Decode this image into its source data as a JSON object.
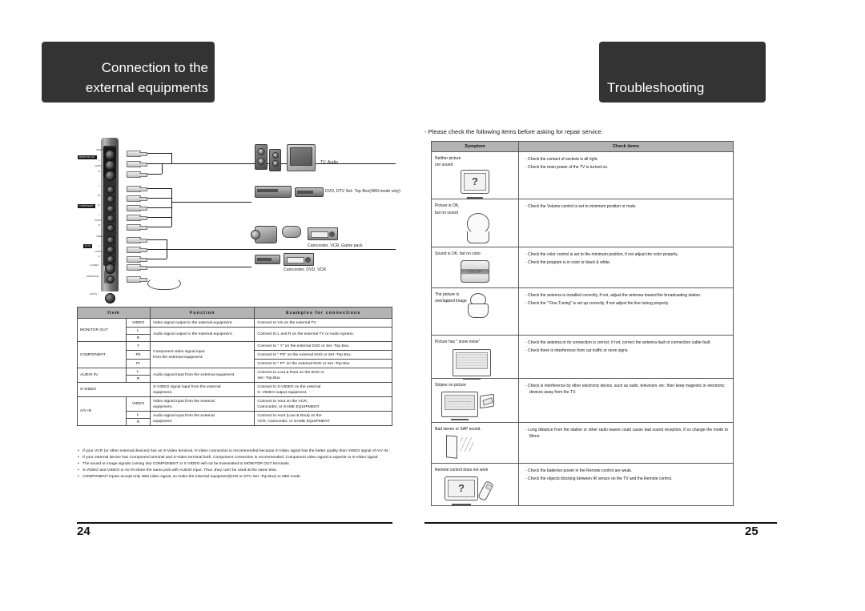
{
  "headers": {
    "left_line1": "Connection to the",
    "left_line2": "external equipments",
    "right": "Troubleshooting"
  },
  "left_page": {
    "page_number": "24",
    "diagram": {
      "panel_labels": [
        "VIDEO",
        "L",
        "AUDIO",
        "R",
        "Y",
        "Pb",
        "Pr",
        "L",
        "AUDIO",
        "R",
        "VIDEO",
        "L",
        "AUDIO",
        "R",
        "S-VIDEO",
        "EARPHONE",
        "ANT IN"
      ],
      "group_labels": [
        "MONITOR OUT",
        "COMPONENT",
        "AV IN"
      ],
      "device_captions": [
        "TV, Audio",
        "DVD, DTV Set- Top Box(480i mode only)",
        "Camcorder, VCR, Game pack",
        "Camcorder, DVD, VCR"
      ]
    },
    "table": {
      "headers": [
        "Item",
        "Function",
        "Examples for connections"
      ],
      "rows": [
        {
          "item": "MONITOR OUT",
          "sub": "VIDEO",
          "function": [
            "Video signal output to the external equipment."
          ],
          "example": [
            "Connect to Vin on the external TV."
          ]
        },
        {
          "item": "",
          "sub": "L",
          "function": [
            "Audio signal output to the external equipment."
          ],
          "example": [
            "Connect to L and R on the external TV or Audio system."
          ]
        },
        {
          "item": "",
          "sub": "R",
          "function": [],
          "example": []
        },
        {
          "item": "COMPONENT",
          "sub": "Y",
          "function": [
            "Component video signal input",
            "from the external equipment."
          ],
          "example": [
            "Connect to \" Y\"  on the external DVD or Set -Top Box."
          ]
        },
        {
          "item": "",
          "sub": "Pb",
          "function": [],
          "example": [
            "Connect to \" Pb\"  on the external DVD or Set -Top Box."
          ]
        },
        {
          "item": "",
          "sub": "Pr",
          "function": [],
          "example": [
            "Connect to \" Pr\"  on the external DVD or Set -Top Box"
          ]
        },
        {
          "item": "AUDIO IN",
          "sub": "L",
          "function": [
            "Audio signal input from the external equipment."
          ],
          "example": [
            "Connect to Lout & Rout on the DVD or",
            "Set -Top Box."
          ]
        },
        {
          "item": "",
          "sub": "R",
          "function": [],
          "example": []
        },
        {
          "item": "S-VIDEO",
          "sub": "",
          "function": [
            "S-VIDEO signal input from the external",
            "equipment."
          ],
          "example": [
            "Connect to S-VIDEO on the external",
            "S -VIDEO output equipment."
          ]
        },
        {
          "item": "A/V IN",
          "sub": "VIDEO",
          "function": [
            "Video signal input from the external",
            "equipment."
          ],
          "example": [
            "Connect to Vout on the VCR,",
            "Camcorder, or GAME EQUIPMENT."
          ]
        },
        {
          "item": "",
          "sub": "L",
          "function": [
            "Audio signal input from the external",
            "equipment."
          ],
          "example": [
            "Connect to Aout (Lout & Rout) on the",
            "VCR, Camcorder, or GAME EQUIPMENT."
          ]
        },
        {
          "item": "",
          "sub": "R",
          "function": [],
          "example": []
        }
      ]
    },
    "notes": [
      "If your VCR (or other external devices) has an S-Video terminal, S-Video connection is recommended because S-Video signal has the better quality than VIDEO signal of A/V IN..",
      "If your external device has Component terminal and S-Video terminal both, Component connection is recommended. Component video signal is superior to S-Video signal.",
      "The sound or image signals coming into COMPONENT or S VIDEO will not be transmitted to MONITOR OUT terminals.",
      "S-VIDEO and VIDEO in AV IN share the same jack with AUDIO input. Thus ,they can't be used at the same time.",
      "COMPONENT inputs accept only 480i video signal, so make the external equipment(DVD or  DTV Set -Top Box) to 480i mode."
    ]
  },
  "right_page": {
    "page_number": "25",
    "intro": "- Please check the following items before asking for repair service.",
    "table": {
      "headers": [
        "Symptom",
        "Check items"
      ],
      "rows": [
        {
          "symptom": [
            "Neither picture",
            "nor sound"
          ],
          "icon": "monitor-question-icon",
          "checks": [
            "- Check the contact of sockets is all right.",
            "- Check the main power of the TV is turned on."
          ]
        },
        {
          "symptom": [
            "Picture is OK,",
            "but no sound"
          ],
          "icon": "person-no-sound-icon",
          "checks": [
            "- Check the Volume control is set to minimum position or mute."
          ]
        },
        {
          "symptom": [
            "Sound is OK, but no color."
          ],
          "icon": "color-knob-icon",
          "checks": [
            "- Check the color control is set to the minimum position, if not adjust the color properly.",
            "- Check the program is in color or black & white."
          ]
        },
        {
          "symptom": [
            "The picture is",
            "overlapped image"
          ],
          "icon": "person-overlapped-icon",
          "checks": [
            "- Check the antenna is installed correctly, if not, adjust the antenna toward the broadcasting station.",
            "- Check the \" Fine Tuning\"  is set up correctly, if not adjust the line tuning properly."
          ]
        },
        {
          "symptom": [
            "Picture has \" snow noise\""
          ],
          "icon": "snow-noise-tv-icon",
          "checks": [
            "- Check the antenna or its connection is correct, if not, correct the antenna fault or connection cable fault.",
            "- Check there is interference from car traffic or neon signs."
          ]
        },
        {
          "symptom": [
            "Stripes on picture"
          ],
          "icon": "stripes-tv-radio-icon",
          "checks": [
            "- Check is interference by other electronic device, such as radio, television, etc. then keep magnetic or electronic devices away from the TV."
          ]
        },
        {
          "symptom": [
            "Bad stereo or SAP sound."
          ],
          "icon": "speaker-waves-icon",
          "checks": [
            "- Long distance from the station or other radio waves could cause bad sound reception, if so change the mode to Mono"
          ]
        },
        {
          "symptom": [
            "Remote control does not work"
          ],
          "icon": "tv-remote-icon",
          "checks": [
            "- Check the batteries power in the Remote control are weak.",
            "- Check the objects blocking between IR sensor on the TV and the Remote control."
          ]
        }
      ]
    }
  },
  "colors": {
    "header_bg": "#333333",
    "table_header_bg": "#b3b3b3",
    "text": "#111111",
    "border": "#4d4d4d"
  }
}
